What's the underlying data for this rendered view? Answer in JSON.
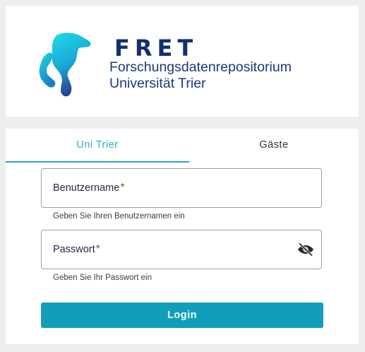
{
  "logo": {
    "title": "FRET",
    "subtitle_line1": "Forschungsdatenrepositorium",
    "subtitle_line2": "Universität Trier",
    "icon": "fret-dog-logo",
    "colors": {
      "gradient_start": "#1fd6e6",
      "gradient_end": "#2a3f8f",
      "text": "#122f6d"
    }
  },
  "tabs": [
    {
      "label": "Uni Trier",
      "active": true
    },
    {
      "label": "Gäste",
      "active": false
    }
  ],
  "form": {
    "username": {
      "label": "Benutzername",
      "required_mark": "*",
      "hint": "Geben Sie Ihren Benutzernamen ein",
      "value": ""
    },
    "password": {
      "label": "Passwort",
      "required_mark": "*",
      "hint": "Geben Sie Ihr Passwort ein",
      "value": "",
      "toggle_icon": "eye-off-icon"
    },
    "submit_label": "Login"
  },
  "colors": {
    "accent": "#2bb1cc",
    "button": "#119ebb",
    "background": "#eeeeee"
  }
}
